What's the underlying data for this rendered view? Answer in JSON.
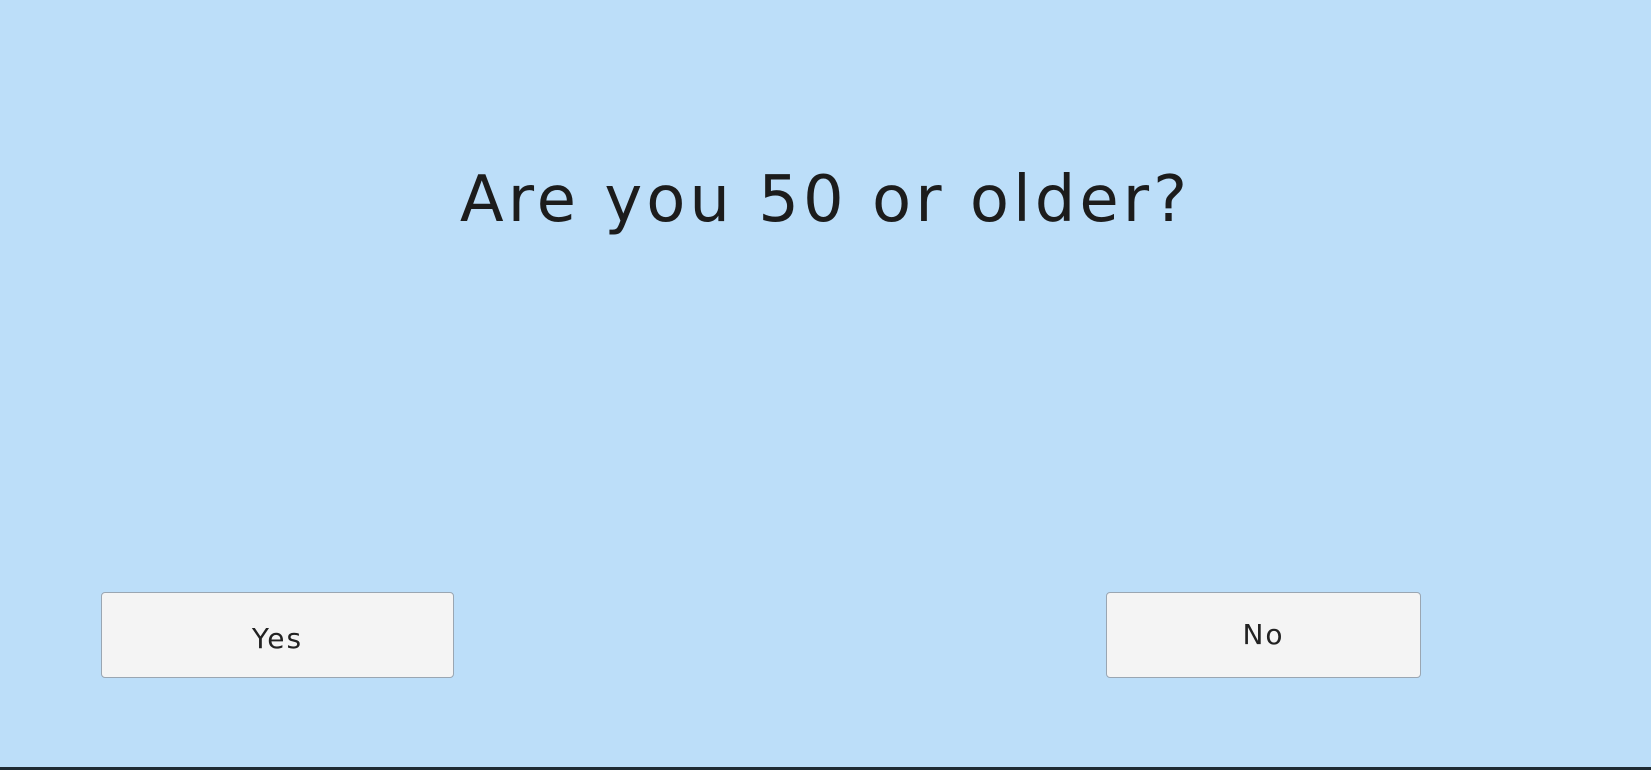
{
  "question": {
    "text": "Are you 50 or older?"
  },
  "buttons": {
    "yes_label": "Yes",
    "no_label": "No"
  },
  "colors": {
    "background": "#bcdef9",
    "button_background": "#f4f4f4",
    "button_border": "#9aa6b2",
    "text": "#1c1c1c"
  }
}
